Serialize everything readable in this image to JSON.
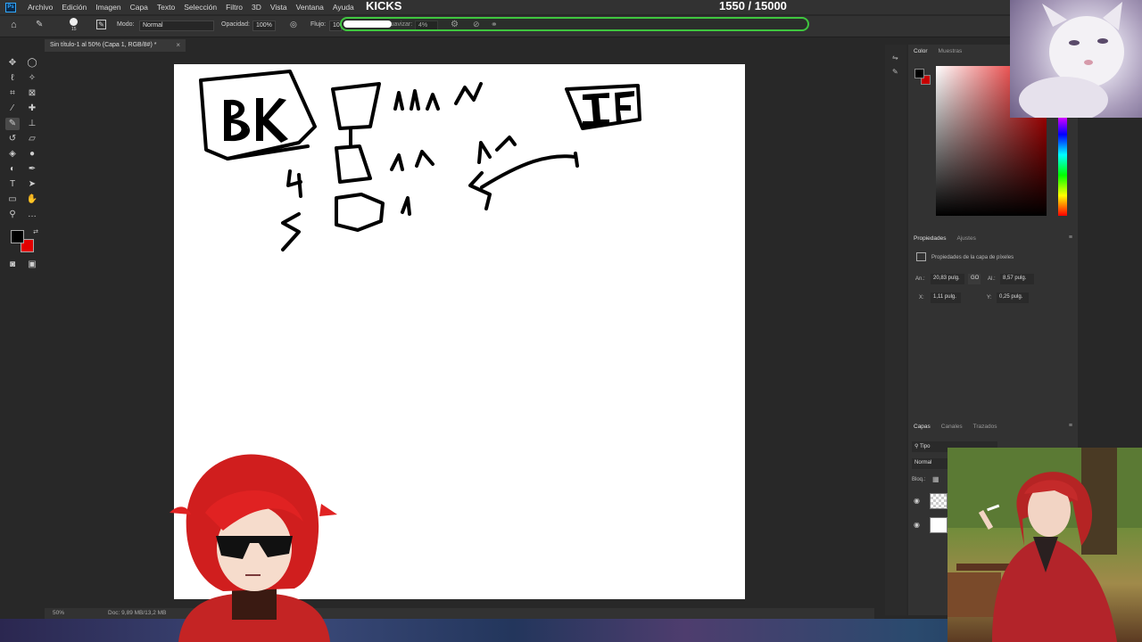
{
  "menu": {
    "logo": "Ps",
    "items": [
      "Archivo",
      "Edición",
      "Imagen",
      "Capa",
      "Texto",
      "Selección",
      "Filtro",
      "3D",
      "Vista",
      "Ventana",
      "Ayuda"
    ]
  },
  "overlay": {
    "kicks_label": "KICKS",
    "counter": "1550  / 15000",
    "kicks_progress": 0.1033
  },
  "options": {
    "brush_size": "15",
    "mode_label": "Modo:",
    "mode_value": "Normal",
    "opacity_label": "Opacidad:",
    "opacity_value": "100%",
    "flow_label": "Flujo:",
    "flow_value": "100",
    "smooth_label": "Suavizar:",
    "smooth_value": "4%"
  },
  "document": {
    "tab_title": "Sin título-1 al 50% (Capa 1, RGB/8#) *",
    "zoom": "50%",
    "doc_info": "Doc: 9,89 MB/13,2 MB"
  },
  "panels": {
    "color_tab": "Color",
    "swatches_tab": "Muestras",
    "properties_tab": "Propiedades",
    "adjustments_tab": "Ajustes",
    "properties_title": "Propiedades de la capa de píxeles",
    "width_label": "An.:",
    "width_value": "20,83 pulg.",
    "link_label": "GO",
    "height_label": "Al.:",
    "height_value": "8,57 pulg.",
    "x_label": "X:",
    "x_value": "1,11 pulg.",
    "y_label": "Y:",
    "y_value": "0,25 pulg.",
    "layers_tab": "Capas",
    "channels_tab": "Canales",
    "paths_tab": "Trazados",
    "layer_filter": "Tipo",
    "blend_mode": "Normal",
    "lock_label": "Bloq.:"
  },
  "canvas_sketch": {
    "box_text": "BK",
    "box2_text": "IF"
  },
  "colors": {
    "foreground": "#000000",
    "background": "#e30000",
    "kicks_bar": "#3fc63f"
  }
}
